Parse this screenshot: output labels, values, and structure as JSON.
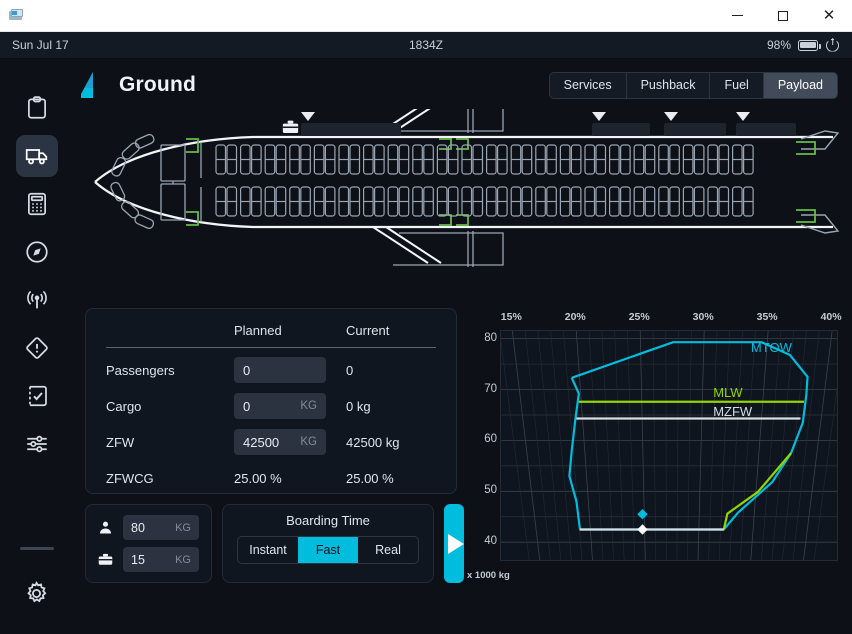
{
  "window": {
    "app_icon": "printer-icon",
    "minimize_label": "–",
    "maximize_label": "□",
    "close_label": "✕"
  },
  "statusbar": {
    "date": "Sun Jul 17",
    "time": "1834Z",
    "battery_percent": "98%",
    "battery_icon": "battery-icon",
    "power_icon": "power-icon"
  },
  "sidebar": {
    "items": [
      {
        "name": "dispatch",
        "icon": "clipboard-icon",
        "active": false
      },
      {
        "name": "ground",
        "icon": "truck-icon",
        "active": true
      },
      {
        "name": "performance",
        "icon": "calculator-icon",
        "active": false
      },
      {
        "name": "navigation",
        "icon": "compass-icon",
        "active": false
      },
      {
        "name": "atc",
        "icon": "broadcast-icon",
        "active": false
      },
      {
        "name": "failures",
        "icon": "warning-diamond-icon",
        "active": false
      },
      {
        "name": "checklists",
        "icon": "checklist-icon",
        "active": false
      },
      {
        "name": "presets",
        "icon": "sliders-icon",
        "active": false
      }
    ],
    "settings": {
      "name": "settings",
      "icon": "gear-icon"
    }
  },
  "header": {
    "logo": "tail-fin-logo",
    "title": "Ground",
    "tabs": [
      {
        "label": "Services",
        "active": false
      },
      {
        "label": "Pushback",
        "active": false
      },
      {
        "label": "Fuel",
        "active": false
      },
      {
        "label": "Payload",
        "active": true
      }
    ]
  },
  "aircraft": {
    "forward_bag_icon": "briefcase-icon",
    "holds": [
      {
        "name": "forward-hold",
        "fill_percent": 0
      },
      {
        "name": "aft-hold-1",
        "fill_percent": 0
      },
      {
        "name": "aft-hold-2",
        "fill_percent": 0
      },
      {
        "name": "bulk-hold",
        "fill_percent": 0
      }
    ]
  },
  "payload_table": {
    "columns": [
      "",
      "Planned",
      "Current"
    ],
    "rows": [
      {
        "label": "Passengers",
        "planned": "0",
        "planned_unit": "",
        "current": "0"
      },
      {
        "label": "Cargo",
        "planned": "0",
        "planned_unit": "KG",
        "current": "0 kg"
      },
      {
        "label": "ZFW",
        "planned": "42500",
        "planned_unit": "KG",
        "current": "42500 kg"
      },
      {
        "label": "ZFWCG",
        "planned": "25.00 %",
        "planned_unit": "",
        "current": "25.00 %"
      }
    ]
  },
  "weights": {
    "per_pax": {
      "icon": "person-icon",
      "value": "80",
      "unit": "KG"
    },
    "per_bag": {
      "icon": "briefcase-icon",
      "value": "15",
      "unit": "KG"
    }
  },
  "boarding": {
    "title": "Boarding Time",
    "options": [
      {
        "label": "Instant",
        "active": false
      },
      {
        "label": "Fast",
        "active": true
      },
      {
        "label": "Real",
        "active": false
      }
    ],
    "start_button": {
      "name": "start-boarding",
      "icon": "play-icon"
    }
  },
  "colors": {
    "accent": "#00bcdd",
    "mtow": "#00bcdd",
    "mlw": "#93d500",
    "mzfw": "#d8dde4",
    "panel": "#101620",
    "background": "#0d1117"
  },
  "chart_data": {
    "type": "line",
    "title": "",
    "xlabel": "",
    "ylabel": "x 1000 kg",
    "xlim": [
      13.0,
      41.5
    ],
    "ylim": [
      36.5,
      81.5
    ],
    "xticks": [
      "15%",
      "20%",
      "25%",
      "30%",
      "35%",
      "40%"
    ],
    "xtick_values": [
      15,
      20,
      25,
      30,
      35,
      40
    ],
    "yticks": [
      "80",
      "70",
      "60",
      "50",
      "40"
    ],
    "ytick_values": [
      80,
      70,
      60,
      50,
      40
    ],
    "grid": true,
    "legend": "inline-labels",
    "series": [
      {
        "name": "MTOW",
        "color": "#00bcdd",
        "label": "MTOW",
        "label_x": 34.2,
        "label_y": 78.0,
        "points": [
          [
            19.0,
            72.3
          ],
          [
            19.6,
            69.2
          ],
          [
            19.3,
            64.0
          ],
          [
            19.0,
            58.0
          ],
          [
            18.8,
            53.0
          ],
          [
            19.4,
            48.0
          ],
          [
            19.7,
            42.5
          ],
          [
            31.9,
            42.5
          ],
          [
            33.1,
            45.8
          ],
          [
            36.0,
            51.8
          ],
          [
            37.6,
            57.5
          ],
          [
            38.6,
            63.5
          ],
          [
            38.9,
            69.0
          ],
          [
            39.0,
            72.5
          ],
          [
            37.5,
            76.8
          ],
          [
            35.1,
            79.3
          ],
          [
            27.6,
            79.3
          ],
          [
            19.0,
            72.3
          ]
        ]
      },
      {
        "name": "MLW",
        "color": "#93d500",
        "label": "MLW",
        "label_x": 31.0,
        "label_y": 69.2,
        "points": [
          [
            19.6,
            67.6
          ],
          [
            38.7,
            67.6
          ]
        ]
      },
      {
        "name": "MLW-lower-limit",
        "color": "#93d500",
        "label": "",
        "points": [
          [
            31.9,
            42.5
          ],
          [
            32.2,
            45.6
          ],
          [
            34.8,
            49.9
          ],
          [
            37.6,
            57.5
          ]
        ]
      },
      {
        "name": "MZFW",
        "color": "#d8dde4",
        "label": "MZFW",
        "label_x": 31.0,
        "label_y": 65.4,
        "points": [
          [
            19.4,
            64.3
          ],
          [
            38.4,
            64.3
          ]
        ]
      },
      {
        "name": "MZFW-lower-limit",
        "color": "#d8dde4",
        "label": "",
        "points": [
          [
            19.7,
            42.5
          ],
          [
            31.9,
            42.5
          ]
        ]
      }
    ],
    "markers": [
      {
        "name": "takeoff-cg-marker",
        "x": 25.0,
        "y": 45.5,
        "color": "#00bcdd",
        "shape": "diamond"
      },
      {
        "name": "zfw-cg-marker",
        "x": 25.0,
        "y": 42.5,
        "color": "#ffffff",
        "shape": "diamond"
      }
    ]
  }
}
